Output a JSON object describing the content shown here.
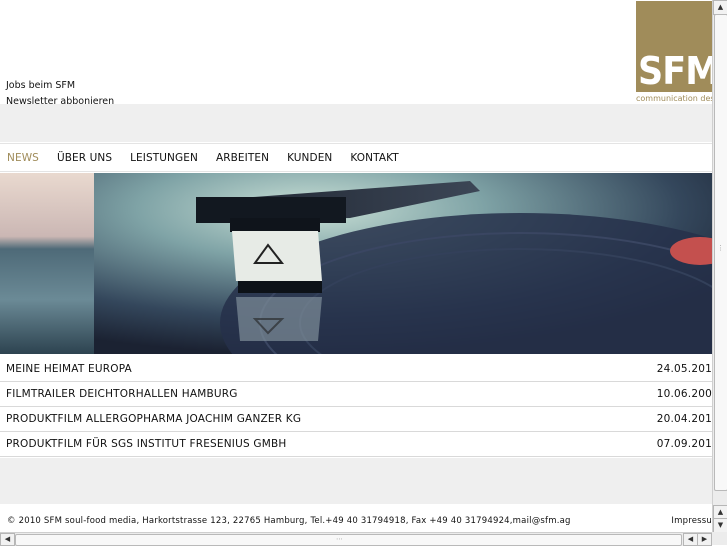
{
  "top_links": [
    "Jobs beim SFM",
    "Newsletter abbonieren"
  ],
  "logo": {
    "text": "SFM",
    "subtitle": "communication des",
    "color": "#a08c5a"
  },
  "nav": {
    "items": [
      "NEWS",
      "ÜBER UNS",
      "LEISTUNGEN",
      "ARBEITEN",
      "KUNDEN",
      "KONTAKT"
    ],
    "active": "NEWS",
    "active_color": "#a08c5a"
  },
  "news": [
    {
      "title": "MEINE HEIMAT EUROPA",
      "date": "24.05.201"
    },
    {
      "title": "FILMTRAILER DEICHTORHALLEN HAMBURG",
      "date": "10.06.200"
    },
    {
      "title": "PRODUKTFILM ALLERGOPHARMA JOACHIM GANZER KG",
      "date": "20.04.201"
    },
    {
      "title": "PRODUKTFILM FÜR SGS INSTITUT FRESENIUS GMBH",
      "date": "07.09.201"
    }
  ],
  "footer": {
    "text": "© 2010 SFM soul-food media, Harkortstrasse 123, 22765 Hamburg, Tel.+49 40 31794918, Fax +49 40 31794924,mail@sfm.ag",
    "link": "Impressu"
  },
  "scrollbar": {
    "up": "▲",
    "down": "▼",
    "left": "◀",
    "right": "▶"
  }
}
